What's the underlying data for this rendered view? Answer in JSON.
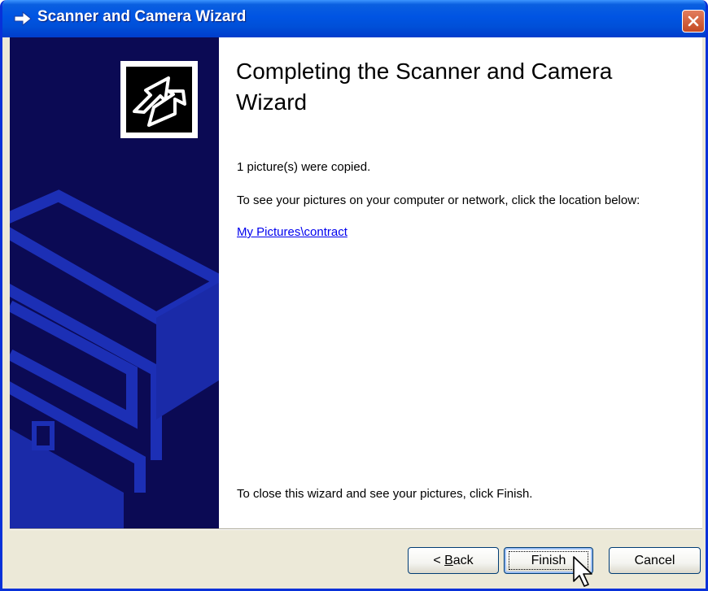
{
  "window": {
    "title": "Scanner and Camera Wizard",
    "title_icon": "wizard-arrow-icon",
    "close_icon": "close-icon"
  },
  "main": {
    "heading": "Completing the Scanner and Camera Wizard",
    "copied_message": "1 picture(s) were copied.",
    "location_message": "To see your pictures on your computer or network, click the location below:",
    "location_link": "My Pictures\\contract",
    "close_message": "To close this wizard and see your pictures, click Finish."
  },
  "buttons": {
    "back_prefix": "< ",
    "back_accel": "B",
    "back_rest": "ack",
    "finish": "Finish",
    "cancel": "Cancel"
  },
  "colors": {
    "titlebar": "#0054e3",
    "banner": "#0b0a54",
    "link": "#0000ee"
  }
}
